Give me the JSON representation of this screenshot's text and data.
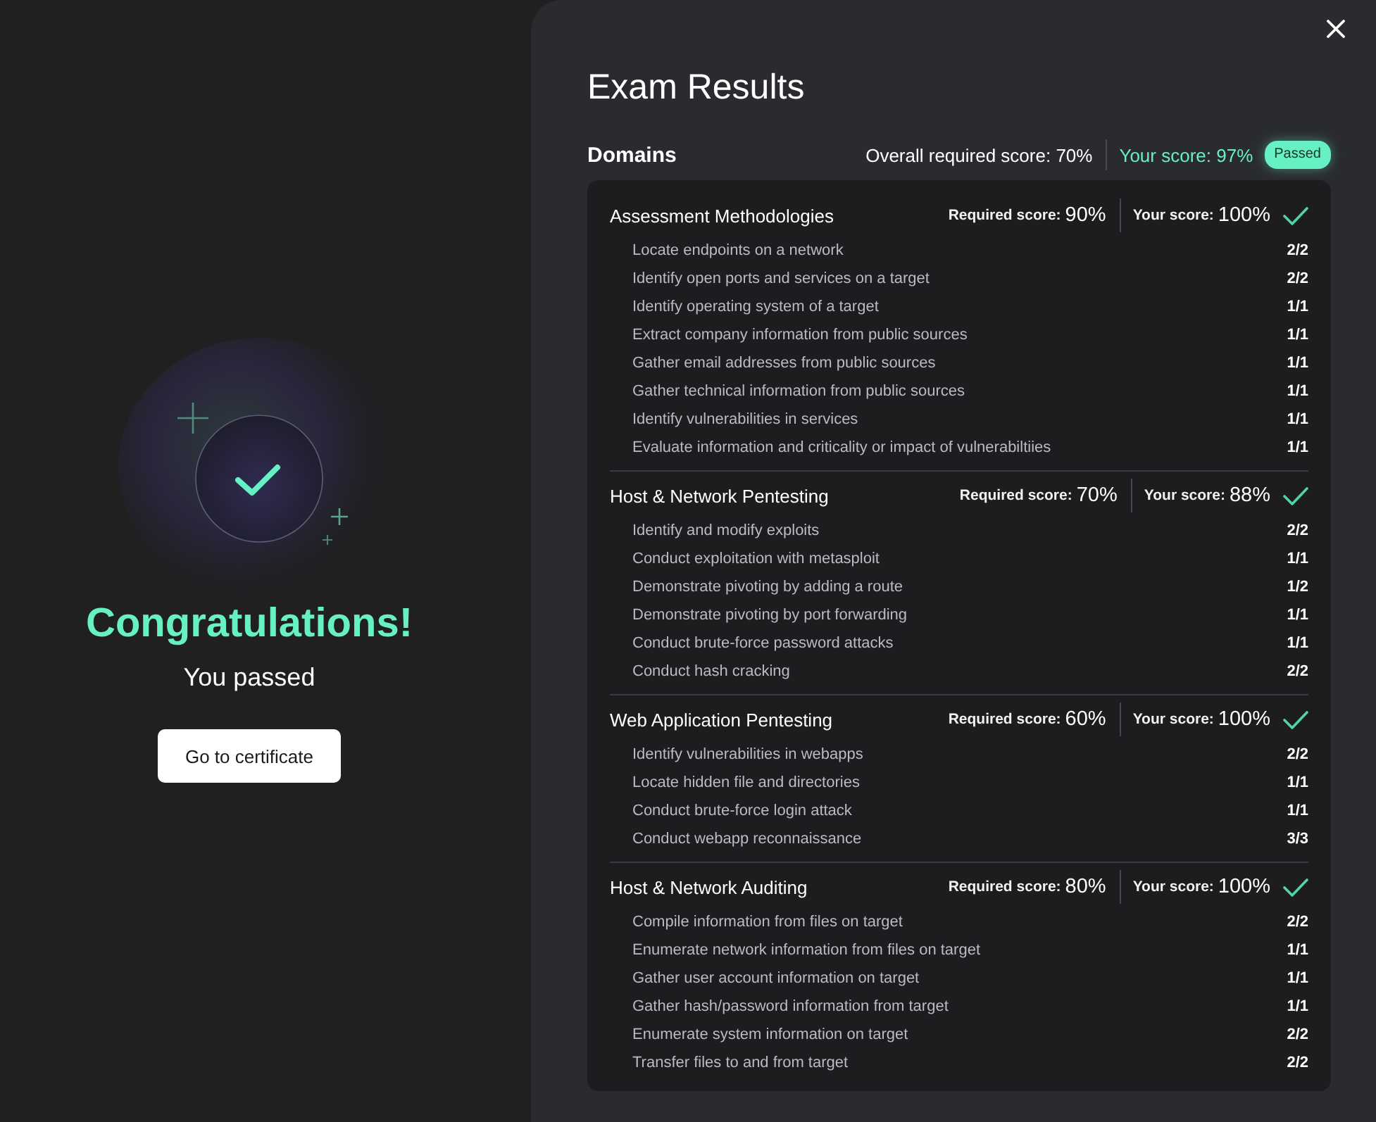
{
  "celebration": {
    "title": "Congratulations!",
    "subtitle": "You passed",
    "button": "Go to certificate"
  },
  "results": {
    "title": "Exam Results",
    "domains_heading": "Domains",
    "overall_required": "Overall required score: 70%",
    "overall_score": "Your score: 97%",
    "status_badge": "Passed",
    "domains": [
      {
        "name": "Assessment Methodologies",
        "required_label": "Required score:",
        "required_value": "90%",
        "score_label": "Your score:",
        "score_value": "100%",
        "passed": true,
        "objectives": [
          {
            "name": "Locate endpoints on a network",
            "score": "2/2"
          },
          {
            "name": "Identify open ports and services on a target",
            "score": "2/2"
          },
          {
            "name": "Identify operating system of a target",
            "score": "1/1"
          },
          {
            "name": "Extract company information from public sources",
            "score": "1/1"
          },
          {
            "name": "Gather email addresses from public sources",
            "score": "1/1"
          },
          {
            "name": "Gather technical information from public sources",
            "score": "1/1"
          },
          {
            "name": "Identify vulnerabilities in services",
            "score": "1/1"
          },
          {
            "name": "Evaluate information and criticality or impact of vulnerabiltiies",
            "score": "1/1"
          }
        ]
      },
      {
        "name": "Host & Network Pentesting",
        "required_label": "Required score:",
        "required_value": "70%",
        "score_label": "Your score:",
        "score_value": "88%",
        "passed": true,
        "objectives": [
          {
            "name": "Identify and modify exploits",
            "score": "2/2"
          },
          {
            "name": "Conduct exploitation with metasploit",
            "score": "1/1"
          },
          {
            "name": "Demonstrate pivoting by adding a route",
            "score": "1/2"
          },
          {
            "name": "Demonstrate pivoting by port forwarding",
            "score": "1/1"
          },
          {
            "name": "Conduct brute-force password attacks",
            "score": "1/1"
          },
          {
            "name": "Conduct hash cracking",
            "score": "2/2"
          }
        ]
      },
      {
        "name": "Web Application Pentesting",
        "required_label": "Required score:",
        "required_value": "60%",
        "score_label": "Your score:",
        "score_value": "100%",
        "passed": true,
        "objectives": [
          {
            "name": "Identify vulnerabilities in webapps",
            "score": "2/2"
          },
          {
            "name": "Locate hidden file and directories",
            "score": "1/1"
          },
          {
            "name": "Conduct brute-force login attack",
            "score": "1/1"
          },
          {
            "name": "Conduct webapp reconnaissance",
            "score": "3/3"
          }
        ]
      },
      {
        "name": "Host & Network Auditing",
        "required_label": "Required score:",
        "required_value": "80%",
        "score_label": "Your score:",
        "score_value": "100%",
        "passed": true,
        "objectives": [
          {
            "name": "Compile information from files on target",
            "score": "2/2"
          },
          {
            "name": "Enumerate network information from files on target",
            "score": "1/1"
          },
          {
            "name": "Gather user account information on target",
            "score": "1/1"
          },
          {
            "name": "Gather hash/password information from target",
            "score": "1/1"
          },
          {
            "name": "Enumerate system information on target",
            "score": "2/2"
          },
          {
            "name": "Transfer files to and from target",
            "score": "2/2"
          }
        ]
      }
    ]
  }
}
